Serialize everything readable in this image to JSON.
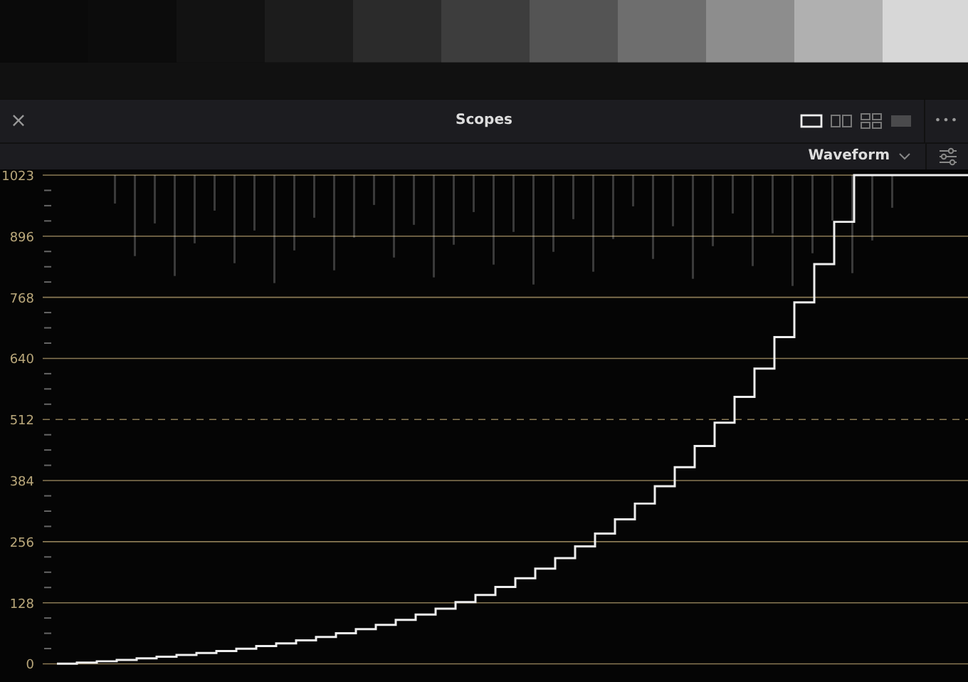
{
  "panel": {
    "close": "×",
    "title": "Scopes",
    "more": "•••",
    "layout_buttons": [
      {
        "selected": true
      },
      {
        "selected": false
      },
      {
        "selected": false
      },
      {
        "selected": false
      }
    ]
  },
  "toolbar": {
    "scope_type": "Waveform"
  },
  "scope": {
    "axis_labels": [
      "1023",
      "896",
      "768",
      "640",
      "512",
      "384",
      "256",
      "128",
      "0"
    ]
  }
}
